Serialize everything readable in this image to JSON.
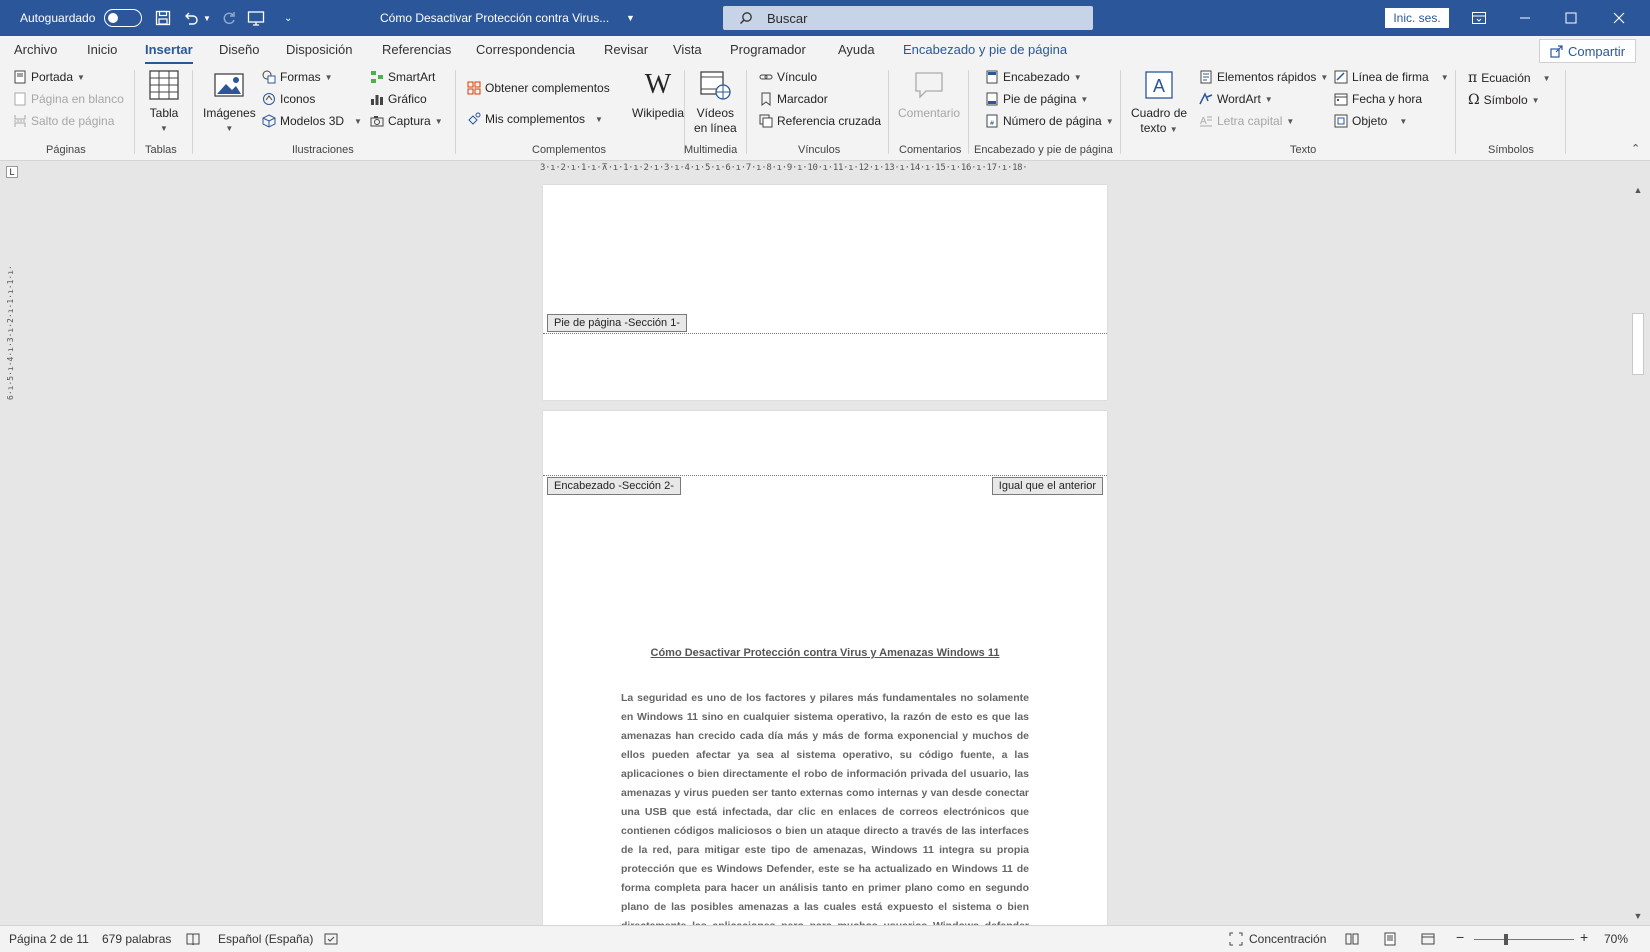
{
  "titlebar": {
    "autosave_label": "Autoguardado",
    "document_title": "Cómo Desactivar Protección contra Virus...",
    "search_placeholder": "Buscar",
    "signin_label": "Inic. ses."
  },
  "menu": {
    "tabs": [
      "Archivo",
      "Inicio",
      "Insertar",
      "Diseño",
      "Disposición",
      "Referencias",
      "Correspondencia",
      "Revisar",
      "Vista",
      "Programador",
      "Ayuda",
      "Encabezado y pie de página"
    ],
    "active_tab": "Insertar",
    "share_label": "Compartir"
  },
  "ribbon": {
    "paginas": {
      "portada": "Portada",
      "pagina_en_blanco": "Página en blanco",
      "salto_de_pagina": "Salto de página",
      "label": "Páginas"
    },
    "tablas": {
      "tabla": "Tabla",
      "label": "Tablas"
    },
    "ilustraciones": {
      "imagenes": "Imágenes",
      "formas": "Formas",
      "iconos": "Iconos",
      "modelos3d": "Modelos 3D",
      "smartart": "SmartArt",
      "grafico": "Gráfico",
      "captura": "Captura",
      "label": "Ilustraciones"
    },
    "complementos": {
      "obtener": "Obtener complementos",
      "mis": "Mis complementos",
      "wikipedia": "Wikipedia",
      "label": "Complementos"
    },
    "multimedia": {
      "videos_line1": "Vídeos",
      "videos_line2": "en línea",
      "label": "Multimedia"
    },
    "vinculos": {
      "vinculo": "Vínculo",
      "marcador": "Marcador",
      "referencia": "Referencia cruzada",
      "label": "Vínculos"
    },
    "comentarios": {
      "comentario": "Comentario",
      "label": "Comentarios"
    },
    "encabezado_pie": {
      "encabezado": "Encabezado",
      "pie": "Pie de página",
      "numero": "Número de página",
      "label": "Encabezado y pie de página"
    },
    "texto": {
      "cuadro_line1": "Cuadro de",
      "cuadro_line2": "texto",
      "elementos": "Elementos rápidos",
      "wordart": "WordArt",
      "letra_capital": "Letra capital",
      "linea_firma": "Línea de firma",
      "fecha_hora": "Fecha y hora",
      "objeto": "Objeto",
      "label": "Texto"
    },
    "simbolos": {
      "ecuacion": "Ecuación",
      "simbolo": "Símbolo",
      "label": "Símbolos"
    }
  },
  "ruler": {
    "horizontal": "3·ı·2·ı·1·ı·⊼·ı·1·ı·2·ı·3·ı·4·ı·5·ı·6·ı·7·ı·8·ı·9·ı·10·ı·11·ı·12·ı·13·ı·14·ı·15·ı·16·ı·17·ı·18·",
    "corner": "L",
    "vertical": "6·ı·5·ı·4·ı·3·ı·2·ı·1·ı·1·ı·"
  },
  "document": {
    "footer_label": "Pie de página -Sección 1-",
    "header_label": "Encabezado -Sección 2-",
    "same_as_previous": "Igual que el anterior",
    "title": "Cómo Desactivar Protección contra Virus y Amenazas Windows 11",
    "body": "La seguridad es uno de los factores y pilares más fundamentales no solamente en Windows 11 sino en cualquier sistema operativo, la razón de esto es que las amenazas han crecido cada día más y más de forma exponencial y muchos de ellos pueden afectar ya sea al sistema operativo, su código fuente, a las aplicaciones o bien directamente el robo  de información privada del usuario, las amenazas y virus pueden ser tanto externas como internas y van desde conectar una USB que está infectada, dar clic en enlaces de correos electrónicos que contienen códigos maliciosos o bien un ataque directo a través de las interfaces de la red, para mitigar este tipo de amenazas, Windows 11 integra su propia protección que es Windows Defender, este se ha actualizado en Windows 11 de forma completa para hacer un análisis tanto en primer plano como en segundo plano de las posibles amenazas a las cuales está expuesto el sistema o bien directamente las aplicaciones pero para muchos usuarios Windows defender posee algunos problemas como son por"
  },
  "statusbar": {
    "page": "Página 2 de 11",
    "words": "679 palabras",
    "language": "Español (España)",
    "focus": "Concentración",
    "zoom": "70%"
  },
  "colors": {
    "brand": "#2b579a",
    "ribbon_bg": "#f3f3f3",
    "canvas_bg": "#e6e6e6"
  }
}
